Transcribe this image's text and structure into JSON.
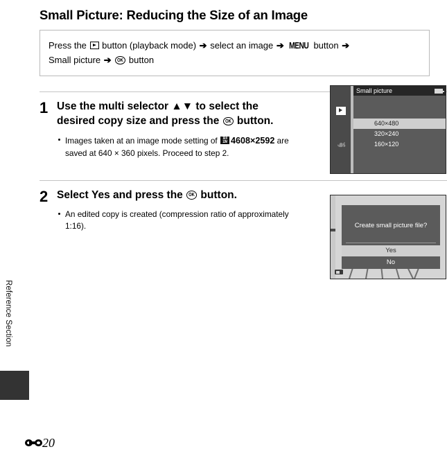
{
  "page": {
    "title": "Small Picture: Reducing the Size of an Image",
    "section_label": "Reference Section",
    "page_number": "20",
    "page_prefix_icon": "reference-section-e-icon"
  },
  "path_box": {
    "line1_a": "Press the",
    "line1_playback_icon": "playback-button-icon",
    "line1_b": "button (playback mode)",
    "line1_arrow1": "➔",
    "line1_c": "select an image",
    "line1_arrow2": "➔",
    "line1_menu_icon": "MENU",
    "line1_d": "button",
    "line1_arrow3": "➔",
    "line2_a": "Small picture",
    "line2_arrow": "➔",
    "line2_ok_icon": "ok-button-icon",
    "line2_b": "button"
  },
  "steps": [
    {
      "number": "1",
      "heading_a": "Use the multi selector ",
      "heading_arrows": "▲▼",
      "heading_b": " to select the desired copy size and press the ",
      "heading_ok_icon": "ok-button-icon",
      "heading_c": " button.",
      "bullets": [
        {
          "text_a": "Images taken at an image mode setting of ",
          "icon": "image-mode-16x9-icon",
          "icon_top": "16:9",
          "icon_bottom": "12M",
          "bold": "4608×2592",
          "text_b": " are saved at 640 × 360 pixels. Proceed to step 2."
        }
      ]
    },
    {
      "number": "2",
      "heading_a": "Select ",
      "heading_bold": "Yes",
      "heading_b": " and press the ",
      "heading_ok_icon": "ok-button-icon",
      "heading_c": " button.",
      "bullets": [
        {
          "text_a": "An edited copy is created (compression ratio of approximately 1:16).",
          "icon": "",
          "icon_top": "",
          "icon_bottom": "",
          "bold": "",
          "text_b": ""
        }
      ]
    }
  ],
  "screen_menu": {
    "title": "Small picture",
    "battery_icon": "battery-icon",
    "playback_icon": "playback-mode-icon",
    "setup_icon": "wrench-setup-icon",
    "options": [
      {
        "label": "640×480",
        "selected": true
      },
      {
        "label": "320×240",
        "selected": false
      },
      {
        "label": "160×120",
        "selected": false
      }
    ]
  },
  "screen_dialog": {
    "message": "Create small picture file?",
    "yes_label": "Yes",
    "no_label": "No",
    "battery_icon": "battery-icon"
  },
  "colors": {
    "menu_bg": "#5b5b5b",
    "menu_sidebar": "#4a4a4a",
    "menu_titlebar": "#262626",
    "selected_row": "#cfcfcf",
    "photo_bg": "#d5d5d5",
    "rule": "#c4c4c4",
    "box_border": "#b9b9b9",
    "tab_block": "#333333"
  }
}
